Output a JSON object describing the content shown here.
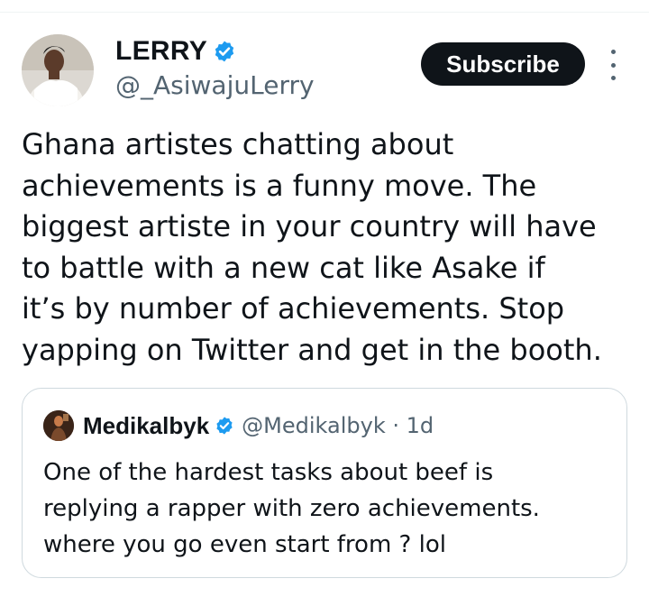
{
  "author": {
    "display_name": "LERRY",
    "handle": "@_AsiwajuLerry",
    "verified": true
  },
  "actions": {
    "subscribe_label": "Subscribe"
  },
  "tweet": {
    "text": "Ghana artistes chatting about\nachievements is a funny move. The\nbiggest artiste in your country will have\nto battle with a new cat like Asake if\nit’s by number of achievements. Stop\nyapping on Twitter and get in the booth."
  },
  "quoted_tweet": {
    "display_name": "Medikalbyk",
    "handle_and_time": "@Medikalbyk · 1d",
    "verified": true,
    "text": "One of the hardest tasks about beef is\nreplying a rapper with zero achievements.\nwhere you go even start from ? lol"
  },
  "colors": {
    "verified_blue": "#1d9bf0",
    "text_primary": "#0f1419",
    "text_secondary": "#536471",
    "border": "#cfd9de"
  }
}
